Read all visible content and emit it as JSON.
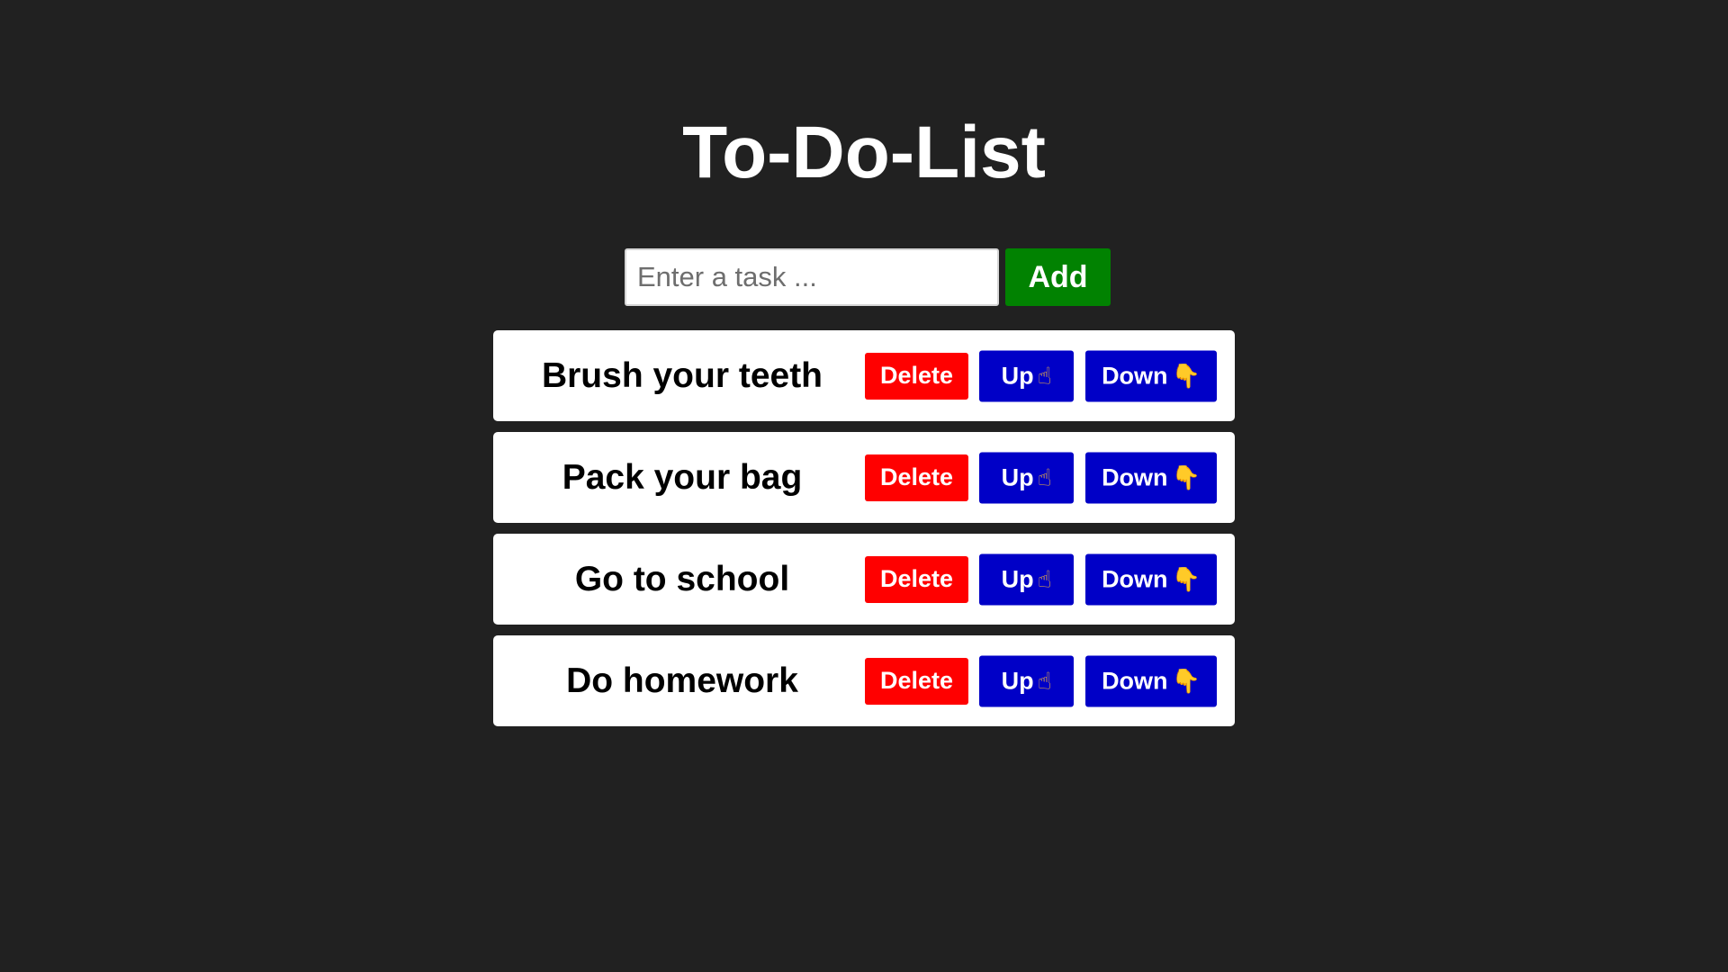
{
  "app": {
    "title": "To-Do-List"
  },
  "input": {
    "placeholder": "Enter a task ...",
    "value": ""
  },
  "add_button": {
    "label": "Add"
  },
  "buttons": {
    "delete_label": "Delete",
    "up_label": "Up",
    "down_label": "Down",
    "up_icon": "☝",
    "down_icon": "👇"
  },
  "tasks": [
    {
      "text": "Brush your teeth"
    },
    {
      "text": "Pack your bag"
    },
    {
      "text": "Go to school"
    },
    {
      "text": "Do homework"
    }
  ],
  "colors": {
    "background": "#212121",
    "add": "#018201",
    "delete": "#ff0000",
    "move": "#0000c7"
  }
}
